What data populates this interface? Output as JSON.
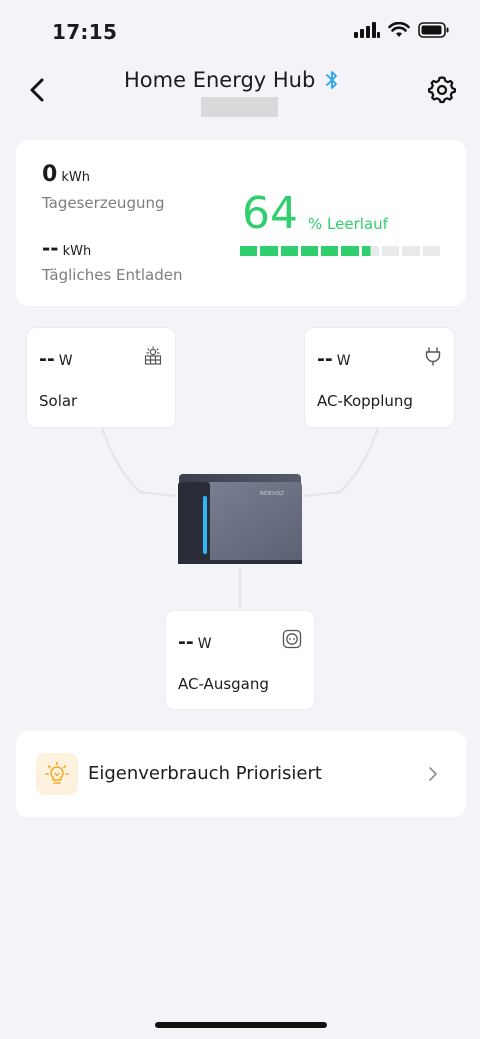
{
  "status_bar": {
    "time": "17:15"
  },
  "nav": {
    "title": "Home Energy Hub"
  },
  "stats": {
    "generation_value": "0",
    "generation_unit": "kWh",
    "generation_label": "Tageserzeugung",
    "discharge_value": "--",
    "discharge_unit": "kWh",
    "discharge_label": "Tägliches Entladen",
    "soc_value": "64",
    "soc_status": "% Leerlauf",
    "soc_level": 0.64
  },
  "nodes": {
    "solar": {
      "value": "--",
      "unit": "W",
      "label": "Solar"
    },
    "ac_coupling": {
      "value": "--",
      "unit": "W",
      "label": "AC-Kopplung"
    },
    "ac_output": {
      "value": "--",
      "unit": "W",
      "label": "AC-Ausgang"
    }
  },
  "device": {
    "brand": "INDEVOLT"
  },
  "mode": {
    "label": "Eigenverbrauch Priorisiert"
  },
  "colors": {
    "accent_green": "#2fcf6e",
    "bluetooth_blue": "#2aa6e6",
    "mode_icon": "#f5a623",
    "background": "#f4f4f8"
  },
  "icons": {
    "solar": "solar-panel-icon",
    "ac_coupling": "plug-icon",
    "ac_output": "socket-icon",
    "mode": "lightbulb-icon",
    "settings": "gear-icon",
    "bluetooth": "bluetooth-icon"
  }
}
